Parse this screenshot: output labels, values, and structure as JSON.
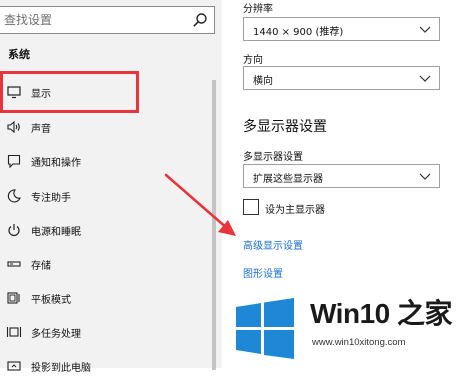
{
  "search": {
    "placeholder": "查找设置"
  },
  "sidebar": {
    "heading": "系统",
    "items": [
      {
        "label": "显示",
        "icon": "monitor-icon"
      },
      {
        "label": "声音",
        "icon": "speaker-icon"
      },
      {
        "label": "通知和操作",
        "icon": "notification-icon"
      },
      {
        "label": "专注助手",
        "icon": "moon-icon"
      },
      {
        "label": "电源和睡眠",
        "icon": "power-icon"
      },
      {
        "label": "存储",
        "icon": "storage-icon"
      },
      {
        "label": "平板模式",
        "icon": "tablet-icon"
      },
      {
        "label": "多任务处理",
        "icon": "multitask-icon"
      },
      {
        "label": "投影到此电脑",
        "icon": "project-icon"
      }
    ]
  },
  "main": {
    "resolution_label": "分辨率",
    "resolution_value": "1440 × 900 (推荐)",
    "orientation_label": "方向",
    "orientation_value": "横向",
    "multi_display_title": "多显示器设置",
    "multi_display_label": "多显示器设置",
    "multi_display_value": "扩展这些显示器",
    "main_display_checkbox": "设为主显示器",
    "advanced_link": "高级显示设置",
    "graphics_link": "图形设置"
  },
  "watermark": {
    "brand": "Win10 之家",
    "url": "www.win10xitong.com"
  },
  "colors": {
    "sidebar_bg": "#f2f2f2",
    "highlight": "#e8343a",
    "link": "#1b6fd1",
    "win_logo": "#1e88d6"
  }
}
